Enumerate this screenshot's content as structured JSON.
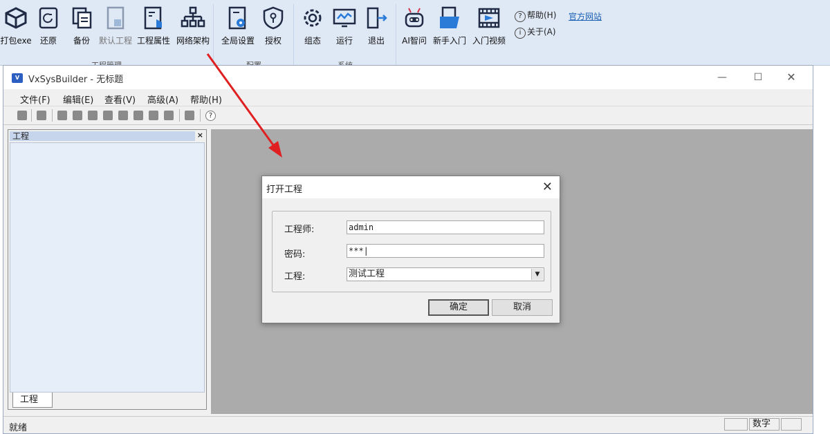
{
  "ribbon": {
    "buttons": [
      {
        "label": "打包exe",
        "icon": "package-cube-icon"
      },
      {
        "label": "还原",
        "icon": "restore-icon"
      },
      {
        "label": "备份",
        "icon": "backup-copy-icon"
      },
      {
        "label": "默认工程",
        "icon": "default-project-icon"
      },
      {
        "label": "工程属性",
        "icon": "project-properties-icon"
      },
      {
        "label": "网络架构",
        "icon": "network-tree-icon"
      },
      {
        "label": "全局设置",
        "icon": "global-settings-icon"
      },
      {
        "label": "授权",
        "icon": "license-shield-icon"
      },
      {
        "label": "组态",
        "icon": "config-gear-icon"
      },
      {
        "label": "运行",
        "icon": "run-monitor-icon"
      },
      {
        "label": "退出",
        "icon": "exit-door-icon"
      },
      {
        "label": "AI智问",
        "icon": "ai-robot-icon"
      },
      {
        "label": "新手入门",
        "icon": "beginner-guide-icon"
      },
      {
        "label": "入门视频",
        "icon": "video-film-icon"
      }
    ],
    "groups": [
      "工程管理",
      "配置",
      "系统"
    ],
    "help_label": "帮助(H)",
    "about_label": "关于(A)",
    "website_label": "官方网站"
  },
  "window": {
    "title": "VxSysBuilder - 无标题",
    "icon_text": "V"
  },
  "menu": [
    "文件(F)",
    "编辑(E)",
    "查看(V)",
    "高级(A)",
    "帮助(H)"
  ],
  "panel": {
    "header": "工程",
    "close": "×",
    "tab": "工程"
  },
  "status": {
    "text": "就绪",
    "num_label": "数字"
  },
  "dialog": {
    "title": "打开工程",
    "close": "✕",
    "engineer_label": "工程师:",
    "engineer_value": "admin",
    "password_label": "密码:",
    "password_value": "***|",
    "project_label": "工程:",
    "project_value": "测试工程",
    "ok_label": "确定",
    "cancel_label": "取消"
  },
  "colors": {
    "ribbon_bg": "#dfe8f5",
    "mdi_bg": "#ababab",
    "accent_blue": "#1a5fb4",
    "annotation_arrow": "#e02020"
  }
}
